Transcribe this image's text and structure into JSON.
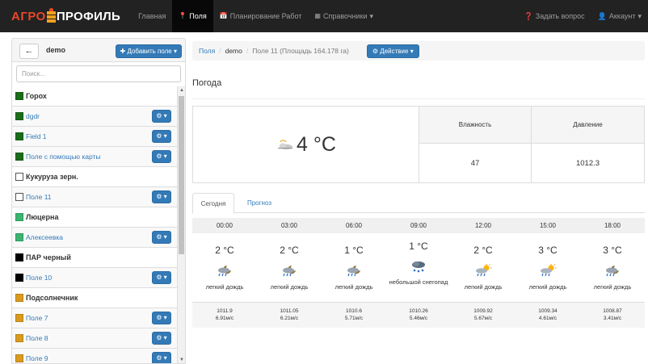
{
  "nav": {
    "brand_left": "АГРО",
    "brand_right": "ПРОФИЛЬ",
    "items": [
      {
        "label": "Главная",
        "icon": "",
        "active": false
      },
      {
        "label": "Поля",
        "icon": "map-marker-icon",
        "active": true
      },
      {
        "label": "Планирование Работ",
        "icon": "calendar-icon",
        "active": false
      },
      {
        "label": "Справочники",
        "icon": "th-icon",
        "active": false,
        "caret": true
      }
    ],
    "help": "Задать вопрос",
    "account": "Аккаунт"
  },
  "sidebar": {
    "title": "demo",
    "back_icon": "arrow-left-icon",
    "add_label": "Добавить поле",
    "search_placeholder": "Поиск...",
    "groups": [
      {
        "name": "Горох",
        "color": "#1a6b1a",
        "hollow": false,
        "fields": [
          "dgdr",
          "Field 1",
          "Поле с помощью карты"
        ]
      },
      {
        "name": "Кукуруза зерн.",
        "color": "#ffffff",
        "hollow": true,
        "fields": [
          "Поле 11"
        ]
      },
      {
        "name": "Люцерна",
        "color": "#3cb371",
        "hollow": false,
        "fields": [
          "Алексеевка"
        ]
      },
      {
        "name": "ПАР черный",
        "color": "#000000",
        "hollow": false,
        "fields": [
          "Поле 10"
        ]
      },
      {
        "name": "Подсолнечник",
        "color": "#d99a1e",
        "hollow": false,
        "fields": [
          "Поле 7",
          "Поле 8",
          "Поле 9"
        ]
      }
    ]
  },
  "breadcrumb": {
    "root": "Поля",
    "sep": "/",
    "middle": "demo",
    "current": "Поле 11 (Площадь 164.178 га)",
    "action_label": "Действие"
  },
  "weather": {
    "title": "Погода",
    "current_temp": "4 °C",
    "humidity_label": "Влажность",
    "humidity_value": "47",
    "pressure_label": "Давление",
    "pressure_value": "1012.3",
    "tabs": [
      "Сегодня",
      "Прогноз"
    ],
    "forecast": [
      {
        "time": "00:00",
        "temp": "2 °C",
        "desc": "легкий дождь",
        "icon": "rain-night-icon",
        "pressure": "1011.9",
        "wind": "6.91м/с"
      },
      {
        "time": "03:00",
        "temp": "2 °C",
        "desc": "легкий дождь",
        "icon": "rain-night-icon",
        "pressure": "1011.05",
        "wind": "6.21м/с"
      },
      {
        "time": "06:00",
        "temp": "1 °C",
        "desc": "легкий дождь",
        "icon": "rain-night-icon",
        "pressure": "1010.6",
        "wind": "5.71м/с"
      },
      {
        "time": "09:00",
        "temp": "1 °C",
        "desc": "небольшой снегопад",
        "icon": "snow-icon",
        "pressure": "1010.26",
        "wind": "5.46м/с"
      },
      {
        "time": "12:00",
        "temp": "2 °C",
        "desc": "легкий дождь",
        "icon": "rain-sun-icon",
        "pressure": "1009.92",
        "wind": "5.67м/с"
      },
      {
        "time": "15:00",
        "temp": "3 °C",
        "desc": "легкий дождь",
        "icon": "rain-sun-icon",
        "pressure": "1009.34",
        "wind": "4.61м/с"
      },
      {
        "time": "18:00",
        "temp": "3 °C",
        "desc": "легкий дождь",
        "icon": "rain-night-icon",
        "pressure": "1008.87",
        "wind": "3.41м/с"
      }
    ]
  }
}
